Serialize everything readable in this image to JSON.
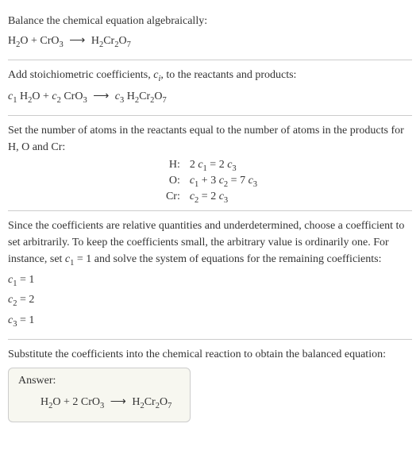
{
  "section1": {
    "title": "Balance the chemical equation algebraically:",
    "lhs1": "H",
    "lhs1s": "2",
    "lhs2": "O + CrO",
    "lhs2s": "3",
    "rhs1": "H",
    "rhs1s": "2",
    "rhs2": "Cr",
    "rhs2s": "2",
    "rhs3": "O",
    "rhs3s": "7",
    "arrow": "⟶"
  },
  "section2": {
    "title_a": "Add stoichiometric coefficients, ",
    "title_c": "c",
    "title_i": "i",
    "title_b": ", to the reactants and products:",
    "c1": "c",
    "c1s": "1",
    "sp1": " H",
    "sp1s": "2",
    "sp2": "O + ",
    "c2": "c",
    "c2s": "2",
    "sp3": " CrO",
    "sp3s": "3",
    "arrow": "⟶",
    "c3": "c",
    "c3s": "3",
    "sp4": " H",
    "sp4s": "2",
    "sp5": "Cr",
    "sp5s": "2",
    "sp6": "O",
    "sp6s": "7"
  },
  "section3": {
    "title": "Set the number of atoms in the reactants equal to the number of atoms in the products for H, O and Cr:",
    "rows": [
      {
        "label": "H:",
        "c1a": "2 ",
        "cv1": "c",
        "cs1": "1",
        "mid": " = 2 ",
        "cv2": "c",
        "cs2": "3",
        "tail": ""
      },
      {
        "label": "O:",
        "c1a": "",
        "cv1": "c",
        "cs1": "1",
        "mid": " + 3 ",
        "cv2": "c",
        "cs2": "2",
        "tail_a": " = 7 ",
        "cv3": "c",
        "cs3": "3"
      },
      {
        "label": "Cr:",
        "c1a": "",
        "cv1": "c",
        "cs1": "2",
        "mid": " = 2 ",
        "cv2": "c",
        "cs2": "3",
        "tail": ""
      }
    ]
  },
  "section4": {
    "title_a": "Since the coefficients are relative quantities and underdetermined, choose a coefficient to set arbitrarily. To keep the coefficients small, the arbitrary value is ordinarily one. For instance, set ",
    "cv": "c",
    "cs": "1",
    "title_b": " = 1 and solve the system of equations for the remaining coefficients:",
    "r1c": "c",
    "r1s": "1",
    "r1v": " = 1",
    "r2c": "c",
    "r2s": "2",
    "r2v": " = 2",
    "r3c": "c",
    "r3s": "3",
    "r3v": " = 1"
  },
  "section5": {
    "title": "Substitute the coefficients into the chemical reaction to obtain the balanced equation:",
    "answer_label": "Answer:",
    "lhs1": "H",
    "lhs1s": "2",
    "lhs2": "O + 2 CrO",
    "lhs2s": "3",
    "arrow": "⟶",
    "rhs1": "H",
    "rhs1s": "2",
    "rhs2": "Cr",
    "rhs2s": "2",
    "rhs3": "O",
    "rhs3s": "7"
  },
  "chart_data": {
    "type": "table",
    "title": "Chemical equation balancing: H2O + CrO3 → H2Cr2O7",
    "atom_balance": [
      {
        "element": "H",
        "equation": "2 c1 = 2 c3"
      },
      {
        "element": "O",
        "equation": "c1 + 3 c2 = 7 c3"
      },
      {
        "element": "Cr",
        "equation": "c2 = 2 c3"
      }
    ],
    "solution": {
      "c1": 1,
      "c2": 2,
      "c3": 1
    },
    "balanced": "H2O + 2 CrO3 → H2Cr2O7"
  }
}
